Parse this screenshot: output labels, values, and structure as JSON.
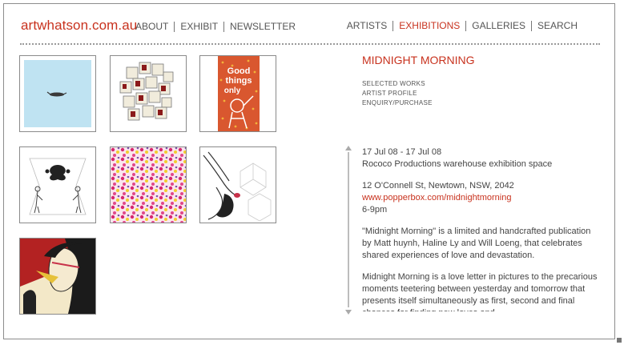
{
  "header": {
    "logo": "artwhatson.com.au",
    "nav_left": [
      "ABOUT",
      "EXHIBIT",
      "NEWSLETTER"
    ],
    "nav_right": [
      "ARTISTS",
      "EXHIBITIONS",
      "GALLERIES",
      "SEARCH"
    ],
    "active_nav": "EXHIBITIONS"
  },
  "exhibition": {
    "title": "MIDNIGHT MORNING",
    "links": [
      "SELECTED WORKS",
      "ARTIST PROFILE",
      "ENQUIRY/PURCHASE"
    ],
    "dates": "17 Jul 08 - 17 Jul 08",
    "venue": "Rococo Productions warehouse exhibition space",
    "address": "12 O'Connell St, Newtown, NSW, 2042",
    "url": "www.popperbox.com/midnightmorning",
    "time": "6-9pm",
    "paragraph1": "\"Midnight Morning\" is a limited and handcrafted publication by Matt huynh, Haline Ly and Will Loeng, that celebrates shared experiences of love and devastation.",
    "paragraph2": "Midnight Morning is a love letter in pictures to the precarious moments teetering between yesterday and tomorrow that presents itself simultaneously as first, second and final chances for finding new loves and"
  },
  "thumbnails": [
    {
      "name": "light blue artwork with small dark figure",
      "bg": "#bfe3f2"
    },
    {
      "name": "cream cube collage artwork",
      "bg": "#f3efe2"
    },
    {
      "name": "good things only poster",
      "text": "Good things only",
      "bg": "#d9572f"
    },
    {
      "name": "ink blot symmetrical figures artwork",
      "bg": "#ffffff"
    },
    {
      "name": "pink and yellow dotted pattern",
      "bg": "#f7d7e4"
    },
    {
      "name": "line drawing of figure with hexagon shapes",
      "bg": "#ffffff"
    },
    {
      "name": "comic style illustration of woman",
      "bg": "#b32222"
    }
  ]
}
